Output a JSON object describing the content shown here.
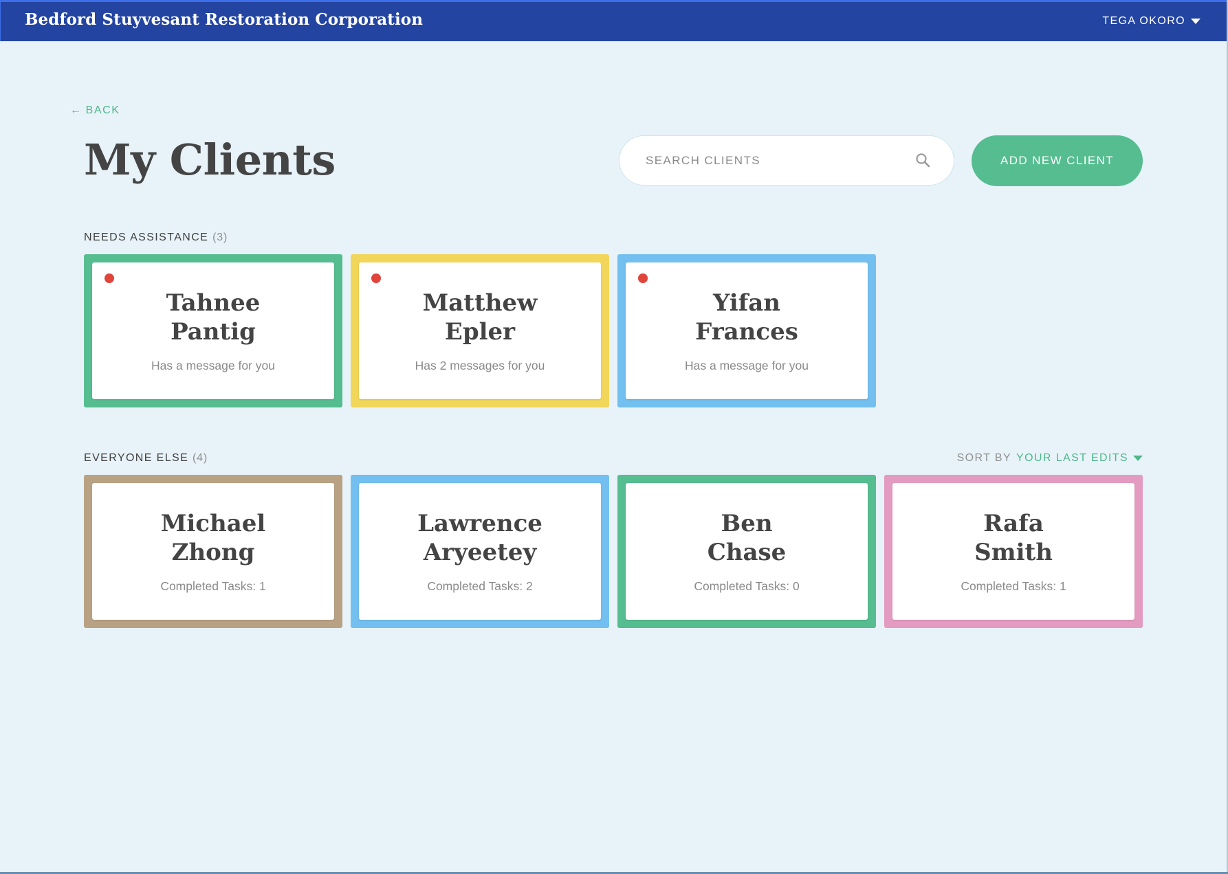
{
  "header": {
    "org_name": "Bedford Stuyvesant Restoration Corporation",
    "user_name": "TEGA OKORO"
  },
  "nav": {
    "back_label": "BACK"
  },
  "page": {
    "title": "My Clients"
  },
  "search": {
    "placeholder": "SEARCH CLIENTS",
    "value": ""
  },
  "actions": {
    "add_client_label": "ADD NEW CLIENT"
  },
  "needs_assistance": {
    "label": "NEEDS ASSISTANCE",
    "count": "(3)",
    "clients": [
      {
        "first_name": "Tahnee",
        "last_name": "Pantig",
        "status": "Has a message for you",
        "color": "#55bd8f",
        "alert": true
      },
      {
        "first_name": "Matthew",
        "last_name": "Epler",
        "status": "Has 2 messages for you",
        "color": "#f2d659",
        "alert": true
      },
      {
        "first_name": "Yifan",
        "last_name": "Frances",
        "status": "Has a message for you",
        "color": "#72bff0",
        "alert": true
      }
    ]
  },
  "everyone_else": {
    "label": "EVERYONE ELSE",
    "count": "(4)",
    "sort_label": "SORT BY",
    "sort_value": "YOUR LAST EDITS",
    "clients": [
      {
        "first_name": "Michael",
        "last_name": "Zhong",
        "status": "Completed Tasks: 1",
        "color": "#b9a283"
      },
      {
        "first_name": "Lawrence",
        "last_name": "Aryeetey",
        "status": "Completed Tasks: 2",
        "color": "#72bff0"
      },
      {
        "first_name": "Ben",
        "last_name": "Chase",
        "status": "Completed Tasks: 0",
        "color": "#55bd8f"
      },
      {
        "first_name": "Rafa",
        "last_name": "Smith",
        "status": "Completed Tasks: 1",
        "color": "#e39bc1"
      }
    ]
  },
  "colors": {
    "header_bg": "#2344a0",
    "page_bg": "#e8f3f9",
    "accent_green": "#55bd8f",
    "alert_red": "#e0443b"
  }
}
